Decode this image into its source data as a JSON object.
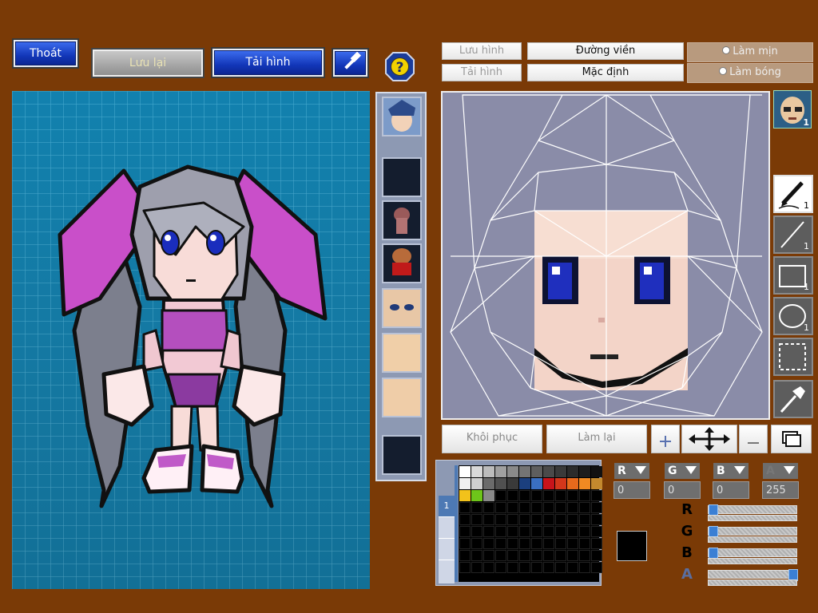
{
  "top_left": {
    "exit_label": "Thoát",
    "save_label": "Lưu lại",
    "reload_label": "Tải hình",
    "hammer_icon": "hammer-icon",
    "help_icon": "help-icon"
  },
  "top_right": {
    "save_image": "Lưu hình",
    "load_image": "Tải hình",
    "outline": "Đường viền",
    "default": "Mặc định",
    "smooth": "Làm mịn",
    "gloss": "Làm bóng"
  },
  "face_thumb_count": "1",
  "tools": [
    {
      "name": "pen",
      "count": "1"
    },
    {
      "name": "line",
      "count": "1"
    },
    {
      "name": "rect",
      "count": "1"
    },
    {
      "name": "ellipse",
      "count": "1"
    },
    {
      "name": "select",
      "count": ""
    },
    {
      "name": "eyedropper",
      "count": ""
    }
  ],
  "edit_buttons": {
    "restore": "Khôi phục",
    "redo": "Làm lại"
  },
  "palette_tab": "1",
  "palette": [
    "#ffffff",
    "#d9d9d9",
    "#bcbcbc",
    "#a0a0a0",
    "#8a8a8a",
    "#747474",
    "#5e5e5e",
    "#4a4a4a",
    "#3a3a3a",
    "#2b2b2b",
    "#1d1d1d",
    "#111111",
    "#f0f0f0",
    "#cfcfcf",
    "#6b6b6b",
    "#505050",
    "#3a3a3a",
    "#1b3f7e",
    "#3a6fc1",
    "#c8141b",
    "#d4371b",
    "#e86a1c",
    "#f08a22",
    "#c48a2e",
    "#f2c21b",
    "#6ec51a",
    "#8a8a8a",
    "#000000",
    "#000000",
    "#000000",
    "#000000",
    "#000000",
    "#000000",
    "#000000",
    "#000000",
    "#000000"
  ],
  "channels": [
    {
      "letter": "R",
      "value": "0"
    },
    {
      "letter": "G",
      "value": "0"
    },
    {
      "letter": "B",
      "value": "0"
    },
    {
      "letter": "A",
      "value": "255"
    }
  ],
  "sliders": [
    {
      "letter": "R",
      "level": 0
    },
    {
      "letter": "G",
      "level": 0
    },
    {
      "letter": "B",
      "level": 0
    },
    {
      "letter": "A",
      "level": 1
    }
  ],
  "current_color": "#000000"
}
